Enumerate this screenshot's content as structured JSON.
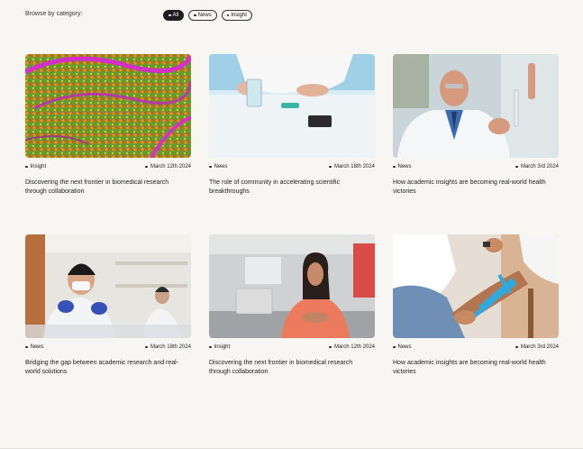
{
  "browse": {
    "label": "Browse by category:",
    "filters": [
      {
        "label": "All"
      },
      {
        "label": "News"
      },
      {
        "label": "Insight"
      }
    ]
  },
  "cards": [
    {
      "category": "Insight",
      "date": "March 12th 2024",
      "title": "Discovering the next frontier in biomedical research through collaboration",
      "image": "microscopy-tissue"
    },
    {
      "category": "News",
      "date": "March 18th 2024",
      "title": "The role of community in accelerating scientific breakthroughs",
      "image": "lab-bench-hands"
    },
    {
      "category": "News",
      "date": "March 3rd 2024",
      "title": "How academic insights are becoming real-world health victories",
      "image": "scientist-pipette"
    },
    {
      "category": "News",
      "date": "March 18th 2024",
      "title": "Bridging the gap between academic research and real-world solutions",
      "image": "lab-researchers"
    },
    {
      "category": "Insight",
      "date": "March 12th 2024",
      "title": "Discovering the next frontier in biomedical research through collaboration",
      "image": "woman-office"
    },
    {
      "category": "News",
      "date": "March 3rd 2024",
      "title": "How academic insights are becoming real-world health victories",
      "image": "knee-taping"
    }
  ]
}
